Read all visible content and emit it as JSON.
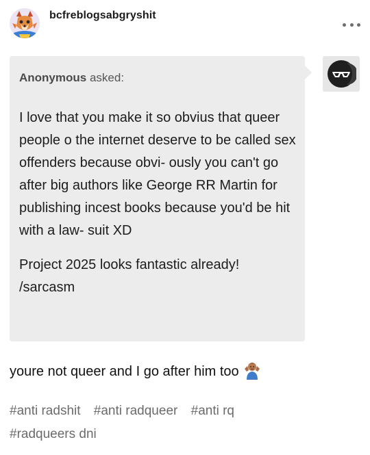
{
  "post": {
    "username": "bcfreblogsabgryshit",
    "menu_icon": "more-dots-icon"
  },
  "ask": {
    "asker": "Anonymous",
    "asked_suffix": "asked:",
    "paragraphs": [
      "I love that you make it so obvius that queer people o the internet deserve to be called sex offenders because obvi- ously you can't go after big authors like George RR Martin for publishing incest books because you'd be hit with a law- suit XD",
      "Project 2025 looks fantastic already! /sarcasm"
    ],
    "asker_avatar_icon": "anonymous-sunglasses-icon"
  },
  "reply": {
    "text": "youre not queer and I go after him too",
    "emoji_icon": "person-shrugging-emoji"
  },
  "tags": [
    "#anti radshit",
    "#anti radqueer",
    "#anti rq",
    "#radqueers dni"
  ],
  "colors": {
    "ask_background": "#ececec",
    "tag_text": "#6b6b6b"
  }
}
